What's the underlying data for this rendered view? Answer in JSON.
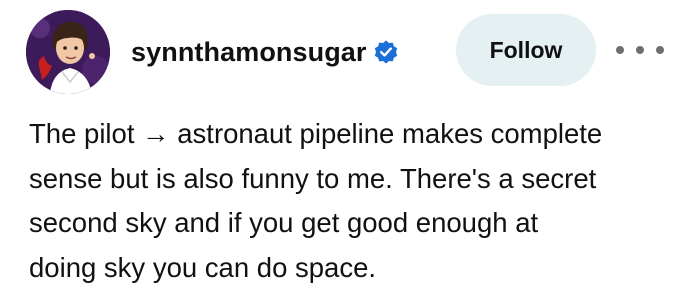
{
  "post": {
    "username": "synnthamonsugar",
    "verified_icon": "verified-badge-icon",
    "follow_label": "Follow",
    "more_icon": "more-options-icon",
    "text_lines": [
      "The pilot → astronaut pipeline makes complete",
      "sense but is also funny to me. There's a secret",
      "second sky and if you get good enough at",
      "doing sky you can do space."
    ]
  },
  "colors": {
    "follow_bg": "#e4f0f1",
    "verified_blue": "#1d6fd8",
    "avatar_bg": "#3d1a5a"
  }
}
